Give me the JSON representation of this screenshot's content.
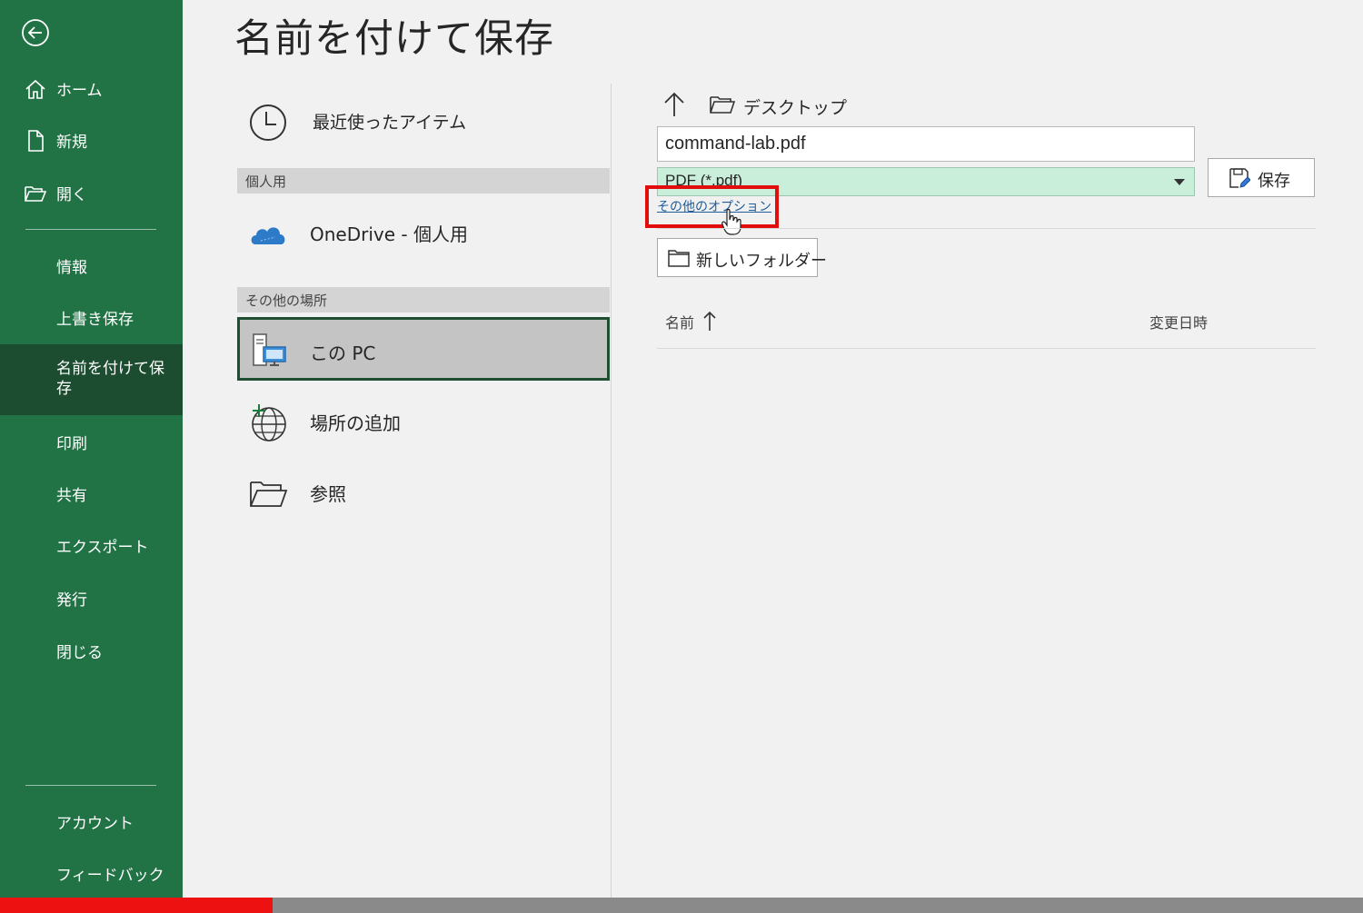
{
  "window": {
    "title": "名前を付けて保存"
  },
  "sidebar": {
    "back_icon": "back-arrow-icon",
    "items": [
      {
        "label": "ホーム",
        "icon": "home-icon"
      },
      {
        "label": "新規",
        "icon": "new-document-icon"
      },
      {
        "label": "開く",
        "icon": "open-folder-icon"
      },
      {
        "label": "情報"
      },
      {
        "label": "上書き保存"
      },
      {
        "label": "名前を付けて保存",
        "selected": true
      },
      {
        "label": "印刷"
      },
      {
        "label": "共有"
      },
      {
        "label": "エクスポート"
      },
      {
        "label": "発行"
      },
      {
        "label": "閉じる"
      },
      {
        "label": "アカウント"
      },
      {
        "label": "フィードバック"
      }
    ]
  },
  "locations": {
    "recent": {
      "label": "最近使ったアイテム",
      "icon": "clock-icon"
    },
    "personal_header": "個人用",
    "onedrive": {
      "label": "OneDrive - 個人用",
      "icon": "cloud-icon"
    },
    "other_header": "その他の場所",
    "this_pc": {
      "label": "この PC",
      "icon": "computer-icon",
      "selected": true
    },
    "add_place": {
      "label": "場所の追加",
      "icon": "globe-add-icon"
    },
    "browse": {
      "label": "参照",
      "icon": "folder-open-icon"
    }
  },
  "file_pane": {
    "location": "デスクトップ",
    "filename": "command-lab.pdf",
    "filetype": "PDF (*.pdf)",
    "more_options": "その他のオプション",
    "save_label": "保存",
    "new_folder_label": "新しいフォルダー",
    "col_name": "名前",
    "col_modified": "変更日時"
  },
  "colors": {
    "sidebar": "#217346",
    "sidebar_selected": "#1d4d31",
    "filetype_bg": "#c9eed9",
    "highlight": "#e20d0d",
    "progress": "#ee1111"
  },
  "progress": {
    "fraction": 0.2
  }
}
